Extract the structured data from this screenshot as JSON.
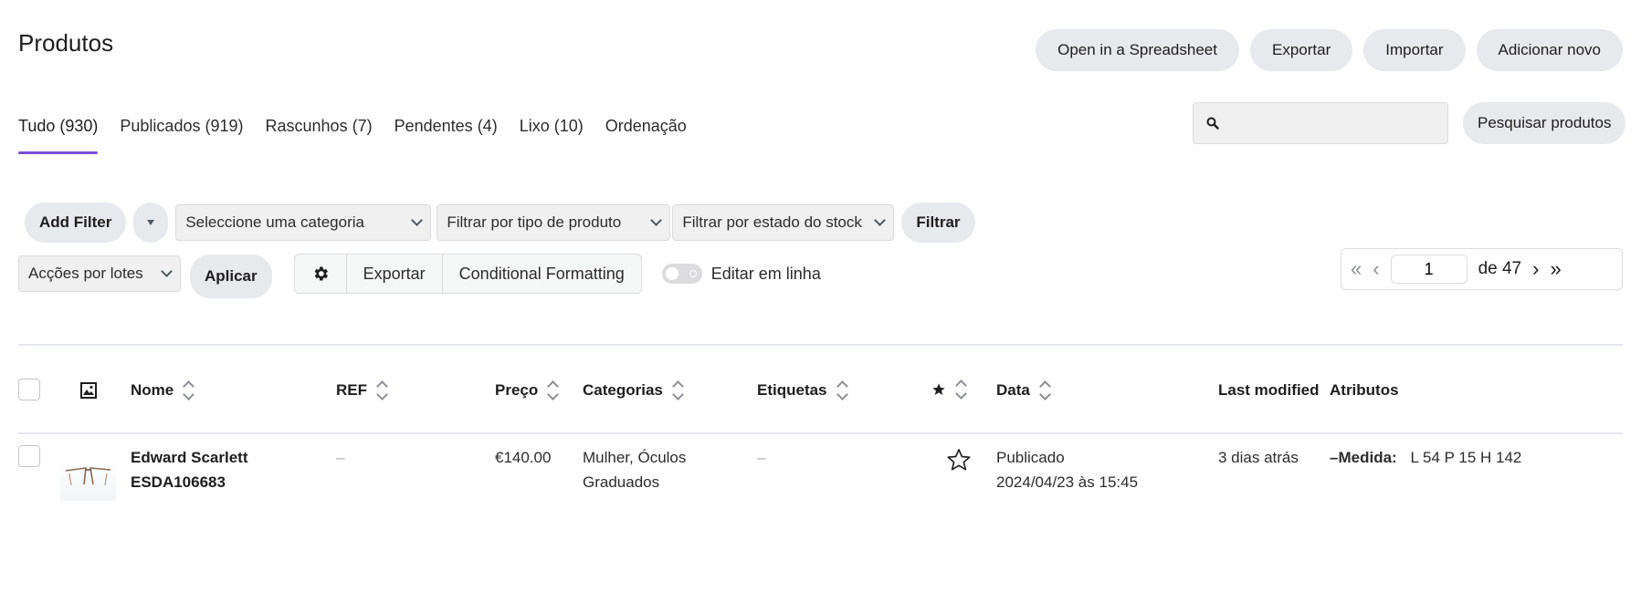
{
  "header": {
    "title": "Produtos",
    "actions": [
      "Open in a Spreadsheet",
      "Exportar",
      "Importar",
      "Adicionar novo"
    ]
  },
  "tabs": [
    {
      "label": "Tudo",
      "count": "(930)",
      "active": true
    },
    {
      "label": "Publicados",
      "count": "(919)"
    },
    {
      "label": "Rascunhos",
      "count": "(7)"
    },
    {
      "label": "Pendentes",
      "count": "(4)"
    },
    {
      "label": "Lixo",
      "count": "(10)"
    },
    {
      "label": "Ordenação",
      "count": ""
    }
  ],
  "search": {
    "placeholder": "",
    "button": "Pesquisar produtos"
  },
  "filters": {
    "add_filter": "Add Filter",
    "category": "Seleccione uma categoria",
    "product_type": "Filtrar por tipo de produto",
    "stock_status": "Filtrar por estado do stock",
    "filter_button": "Filtrar"
  },
  "bulk": {
    "actions": "Acções por lotes",
    "apply": "Aplicar",
    "export": "Exportar",
    "conditional": "Conditional Formatting",
    "inline_edit": "Editar em linha"
  },
  "pagination": {
    "first": "«",
    "prev": "‹",
    "current": "1",
    "of": "de 47",
    "next": "›",
    "last": "»"
  },
  "columns": {
    "name": "Nome",
    "sku": "REF",
    "price": "Preço",
    "categories": "Categorias",
    "tags": "Etiquetas",
    "date": "Data",
    "modified": "Last modified",
    "attributes": "Atributos"
  },
  "rows": [
    {
      "name_line1": "Edward Scarlett",
      "name_line2": "ESDA106683",
      "sku": "–",
      "price": "€140.00",
      "categories_line1": "Mulher, Óculos",
      "categories_line2": "Graduados",
      "tags": "–",
      "status": "Publicado",
      "date": "2024/04/23 às 15:45",
      "modified": "3 dias atrás",
      "attr_prefix": "–",
      "attr_label": "Medida:",
      "attr_value": "L 54 P 15 H 142"
    }
  ],
  "icons": {
    "image_column": "image-icon",
    "featured_column": "star-filled-icon",
    "featured_row": "star-outline-icon",
    "settings": "gear-icon",
    "search": "search-icon"
  }
}
